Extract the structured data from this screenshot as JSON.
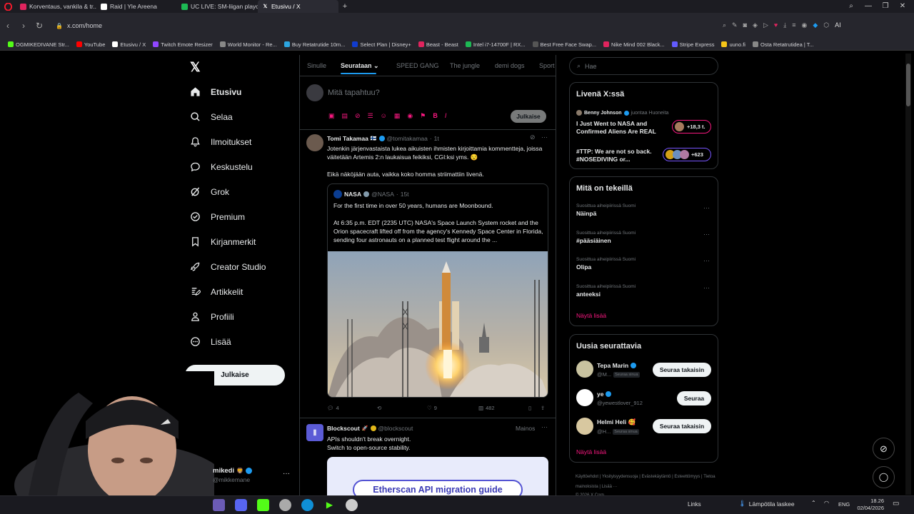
{
  "browser": {
    "tabs": [
      {
        "label": "Korventaus, vankila & tr...",
        "color": "#e0245e"
      },
      {
        "label": "Raid | Yle Areena",
        "color": "#ffffff"
      },
      {
        "label": "UC LIVE: SM-liigan playoff",
        "color": "#1db954"
      },
      {
        "label": "Etusivu / X",
        "color": "#ffffff",
        "active": true
      }
    ],
    "url": "x.com/home",
    "bookmarks": [
      {
        "label": "OGMIKEDIVANE Str...",
        "color": "#53fc18"
      },
      {
        "label": "YouTube",
        "color": "#ff0000"
      },
      {
        "label": "Etusivu / X",
        "color": "#ffffff"
      },
      {
        "label": "Twitch Emote Resizer",
        "color": "#9146ff"
      },
      {
        "label": "World Monitor - Re...",
        "color": "#888888"
      },
      {
        "label": "Buy Retatrutide 10m...",
        "color": "#2ca5e0"
      },
      {
        "label": "Select Plan | Disney+",
        "color": "#113ccf"
      },
      {
        "label": "Beast - Beast",
        "color": "#e0245e"
      },
      {
        "label": "Intel i7-14700F | RX...",
        "color": "#1db954"
      },
      {
        "label": "Best Free Face Swap...",
        "color": "#555555"
      },
      {
        "label": "Nike Mind 002 Black...",
        "color": "#e0245e"
      },
      {
        "label": "Stripe Express",
        "color": "#635bff"
      },
      {
        "label": "uuno.fi",
        "color": "#f5c518"
      },
      {
        "label": "Osta Retatrutidea | T...",
        "color": "#888888"
      }
    ]
  },
  "nav": {
    "items": [
      {
        "label": "Etusivu",
        "icon": "home-icon",
        "bold": true
      },
      {
        "label": "Selaa",
        "icon": "search-icon"
      },
      {
        "label": "Ilmoitukset",
        "icon": "bell-icon"
      },
      {
        "label": "Keskustelu",
        "icon": "chat-icon"
      },
      {
        "label": "Grok",
        "icon": "grok-icon"
      },
      {
        "label": "Premium",
        "icon": "premium-icon"
      },
      {
        "label": "Kirjanmerkit",
        "icon": "bookmark-icon"
      },
      {
        "label": "Creator Studio",
        "icon": "rocket-icon"
      },
      {
        "label": "Artikkelit",
        "icon": "article-icon"
      },
      {
        "label": "Profiili",
        "icon": "person-icon"
      },
      {
        "label": "Lisää",
        "icon": "more-icon"
      }
    ],
    "post_button": "Julkaise",
    "account": {
      "name": "mikedi",
      "handle": "@mikkemane"
    }
  },
  "feed": {
    "tabs": [
      "Sinulle",
      "Seurataan",
      "SPEED GANG",
      "The jungle",
      "demi dogs",
      "Sport"
    ],
    "composer_placeholder": "Mitä tapahtuu?",
    "composer_button": "Julkaise",
    "tweet": {
      "name": "Tomi Takamaa",
      "handle": "@tomitakamaa",
      "time": "1t",
      "text1": "Jotenkin järjenvastaista lukea aikuisten ihmisten kirjoittamia kommentteja, joissa väitetään Artemis 2:n laukaisua feikiksi, CGI:ksi yms. 😒",
      "text2": "Eikä näköjään auta, vaikka koko homma striimattiin livenä.",
      "quote": {
        "name": "NASA",
        "handle": "@NASA",
        "time": "15t",
        "text1": "For the first time in over 50 years, humans are Moonbound.",
        "text2": "At 6:35 p.m. EDT (2235 UTC) NASA's Space Launch System rocket and the Orion spacecraft lifted off from the agency's Kennedy Space Center in Florida, sending four astronauts on a planned test flight around the ..."
      },
      "stats": {
        "replies": "4",
        "likes": "9",
        "views": "482"
      }
    },
    "ad": {
      "name": "Blockscout",
      "handle": "@blockscout",
      "tag": "Mainos",
      "text1": "APIs shouldn't break overnight.",
      "text2": "Switch to open-source stability.",
      "banner": "Etherscan API migration guide"
    }
  },
  "sidebar": {
    "search_placeholder": "Hae",
    "live": {
      "title": "Livenä X:ssä",
      "items": [
        {
          "host": "Benny Johnson",
          "host_suffix": "juontaa Huoneita",
          "title": "I Just Went to NASA and Confirmed Aliens Are REAL",
          "count": "+18,3 t."
        },
        {
          "title": "#TTP: We are not so back. #NOSEDIVING or...",
          "count": "+623"
        }
      ]
    },
    "trends": {
      "title": "Mitä on tekeillä",
      "items": [
        {
          "context": "Suosittua aiheipiirissä Suomi",
          "name": "Näinpä"
        },
        {
          "context": "Suosittua aiheipiirissä Suomi",
          "name": "#pääsiäinen"
        },
        {
          "context": "Suosittua aiheipiirissä Suomi",
          "name": "Olipa"
        },
        {
          "context": "Suosittua aiheipiirissä Suomi",
          "name": "anteeksi"
        }
      ],
      "show_more": "Näytä lisää"
    },
    "follow": {
      "title": "Uusia seurattavia",
      "items": [
        {
          "name": "Tepa Marin",
          "handle": "@M...",
          "follows_you": "Seuraa sinua",
          "button": "Seuraa takaisin"
        },
        {
          "name": "ye",
          "handle": "@yewestlover_912",
          "button": "Seuraa"
        },
        {
          "name": "Helmi Heli 🥰",
          "handle": "@H...",
          "follows_you": "Seuraa sinua",
          "button": "Seuraa takaisin"
        }
      ],
      "show_more": "Näytä lisää"
    },
    "footer": [
      "Käyttöehdot",
      "Yksityisyydensuoja",
      "Evästekäytäntö",
      "Esteettömyys",
      "Tietoa mainoksista",
      "Lisää ···"
    ],
    "copyright": "© 2026 X Corp."
  },
  "taskbar": {
    "links": "Links",
    "weather": "Lämpötila laskee",
    "lang": "ENG",
    "time": "18.26",
    "date": "02/04/2026"
  }
}
